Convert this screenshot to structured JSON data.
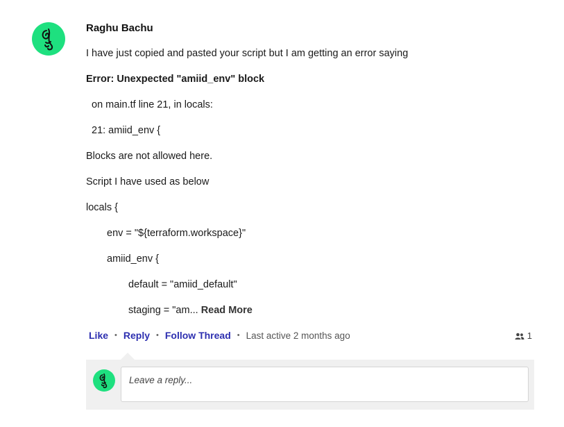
{
  "comment": {
    "author": "Raghu Bachu",
    "avatar_icon": "abstract-face-avatar-icon",
    "avatar_color": "#1ee07f",
    "lines": [
      "I have just copied and pasted your script but I am getting an error saying",
      "Error: Unexpected \"amiid_env\" block",
      "on main.tf line 21, in locals:",
      "21: amiid_env {",
      "Blocks are not allowed here.",
      "Script I have used as below",
      "locals {",
      "env = \"${terraform.workspace}\"",
      "amiid_env {",
      "default = \"amiid_default\"",
      "staging = \"am..."
    ],
    "read_more": "Read More"
  },
  "actions": {
    "like": "Like",
    "reply": "Reply",
    "follow": "Follow Thread",
    "separator": "•",
    "last_active": "Last active 2 months ago",
    "followers_count": "1",
    "followers_icon": "people-icon"
  },
  "reply": {
    "placeholder": "Leave a reply..."
  },
  "colors": {
    "link": "#2d2fb0",
    "reply_bg": "#f0f0f0"
  }
}
